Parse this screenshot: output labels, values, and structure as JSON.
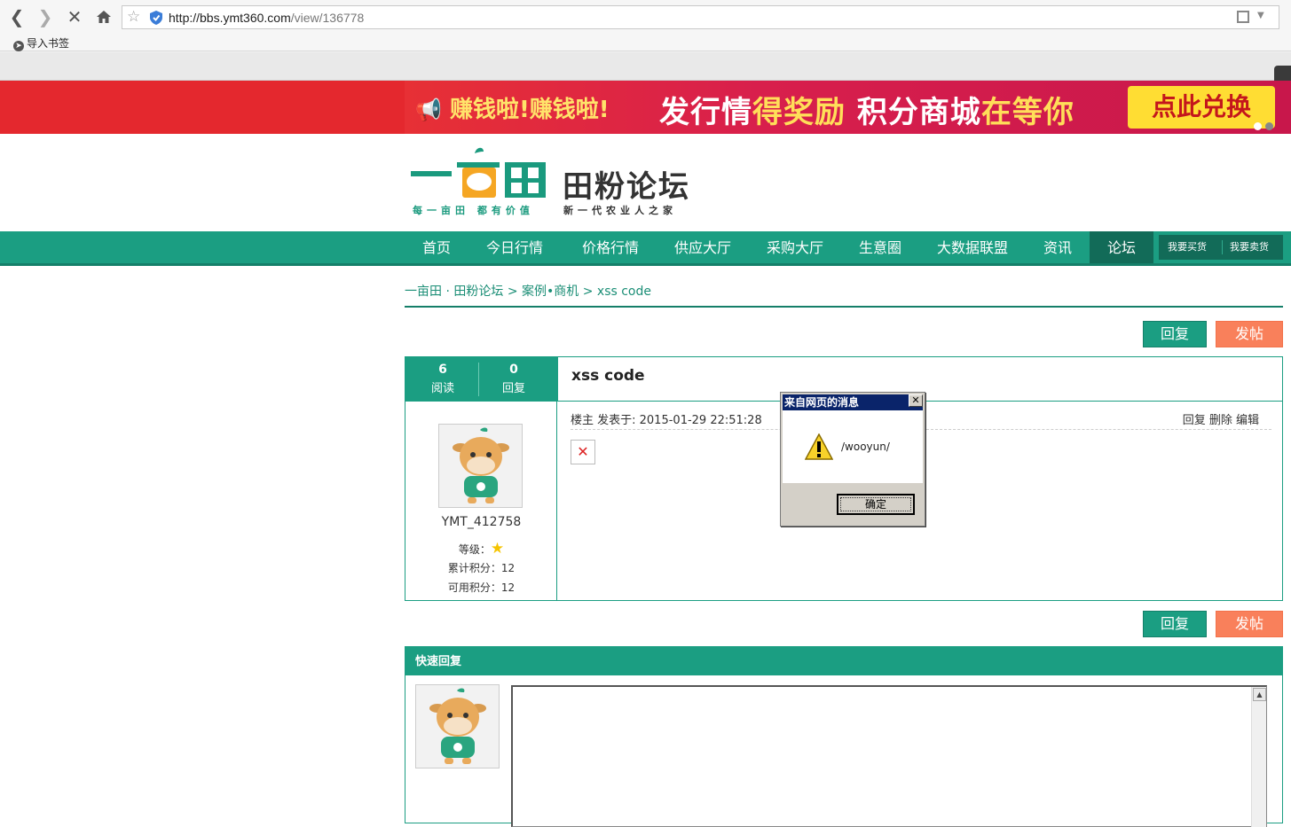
{
  "browser": {
    "url_host": "http://bbs.ymt360.com",
    "url_path": "/view/136778",
    "bookmark_import": "导入书签"
  },
  "banner": {
    "earn_text": "赚钱啦!赚钱啦!",
    "main_text_a": "发行情",
    "main_text_b": "得奖励",
    "main_text_c": " 积分商城",
    "main_text_d": "在等你",
    "cta": "点此兑换"
  },
  "logo": {
    "title": "田粉论坛",
    "slogan_left": "每一亩田 都有价值",
    "slogan_right": "新一代农业人之家"
  },
  "nav": {
    "items": [
      {
        "label": "首页"
      },
      {
        "label": "今日行情"
      },
      {
        "label": "价格行情"
      },
      {
        "label": "供应大厅"
      },
      {
        "label": "采购大厅"
      },
      {
        "label": "生意圈"
      },
      {
        "label": "大数据联盟"
      },
      {
        "label": "资讯"
      },
      {
        "label": "论坛"
      }
    ],
    "buy": "我要买货",
    "sell": "我要卖货"
  },
  "breadcrumb": {
    "home": "一亩田 · 田粉论坛",
    "sep": ">",
    "section": "案例•商机",
    "current": "xss code"
  },
  "buttons": {
    "reply": "回复",
    "post": "发帖"
  },
  "thread": {
    "reads": "6",
    "reads_label": "阅读",
    "replies": "0",
    "replies_label": "回复",
    "title": "xss code",
    "meta": "楼主 发表于: 2015-01-29 22:51:28",
    "actions": "回复 删除 编辑",
    "user": {
      "name": "YMT_412758",
      "level_label": "等级：",
      "total_points": "累计积分：12",
      "available_points": "可用积分：12"
    }
  },
  "quick_reply": {
    "heading": "快速回复"
  },
  "dialog": {
    "title": "来自网页的消息",
    "message": "/wooyun/",
    "ok": "确定"
  },
  "colors": {
    "brand_green": "#1b9e82",
    "post_orange": "#f9805b",
    "banner_red": "#e4282e"
  }
}
